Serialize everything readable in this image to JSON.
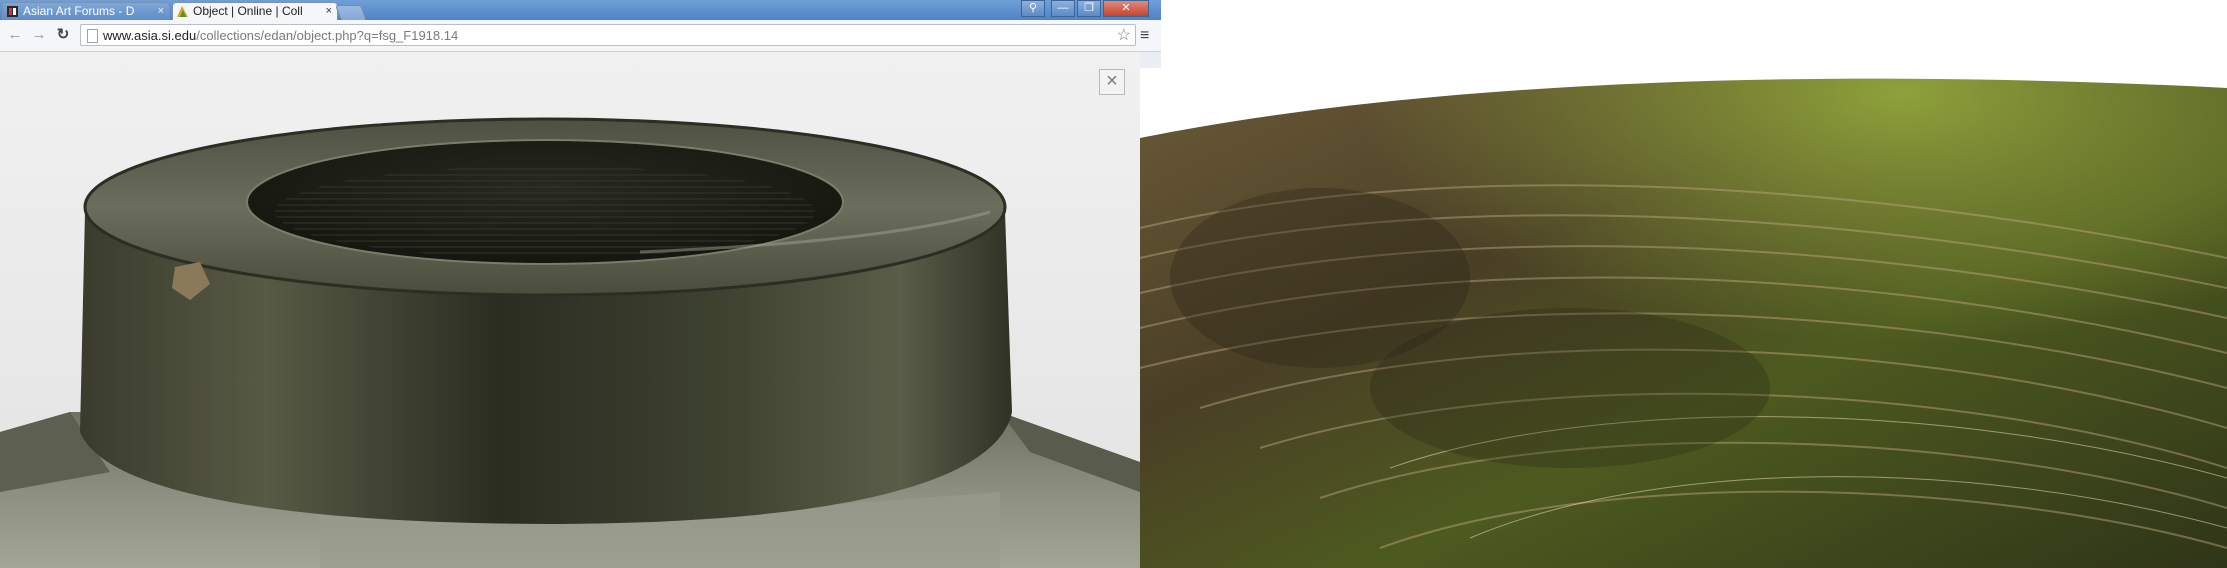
{
  "browser": {
    "tabs": [
      {
        "title": "Asian Art Forums - D",
        "close": "×",
        "active": false
      },
      {
        "title": "Object | Online | Coll",
        "close": "×",
        "active": true
      }
    ],
    "window_controls": {
      "pin": "⚲",
      "minimize": "—",
      "maximize": "❐",
      "close": "✕"
    },
    "nav": {
      "back": "←",
      "forward": "→",
      "reload": "↻"
    },
    "url_host": "www.asia.si.edu",
    "url_path": "/collections/edan/object.php?q=fsg_F1918.14",
    "bookmark_star": "☆",
    "menu": "≡"
  },
  "viewer": {
    "close_label": "×"
  },
  "photos": {
    "main": "jade-vessel-rim-closeup",
    "zoom": "jade-rim-tool-marks-macro"
  },
  "colors": {
    "titlebar": "#5b8dca",
    "jade_dark": "#2e3024",
    "jade_green": "#4d5a22",
    "stone_grey": "#8a8d7e"
  }
}
